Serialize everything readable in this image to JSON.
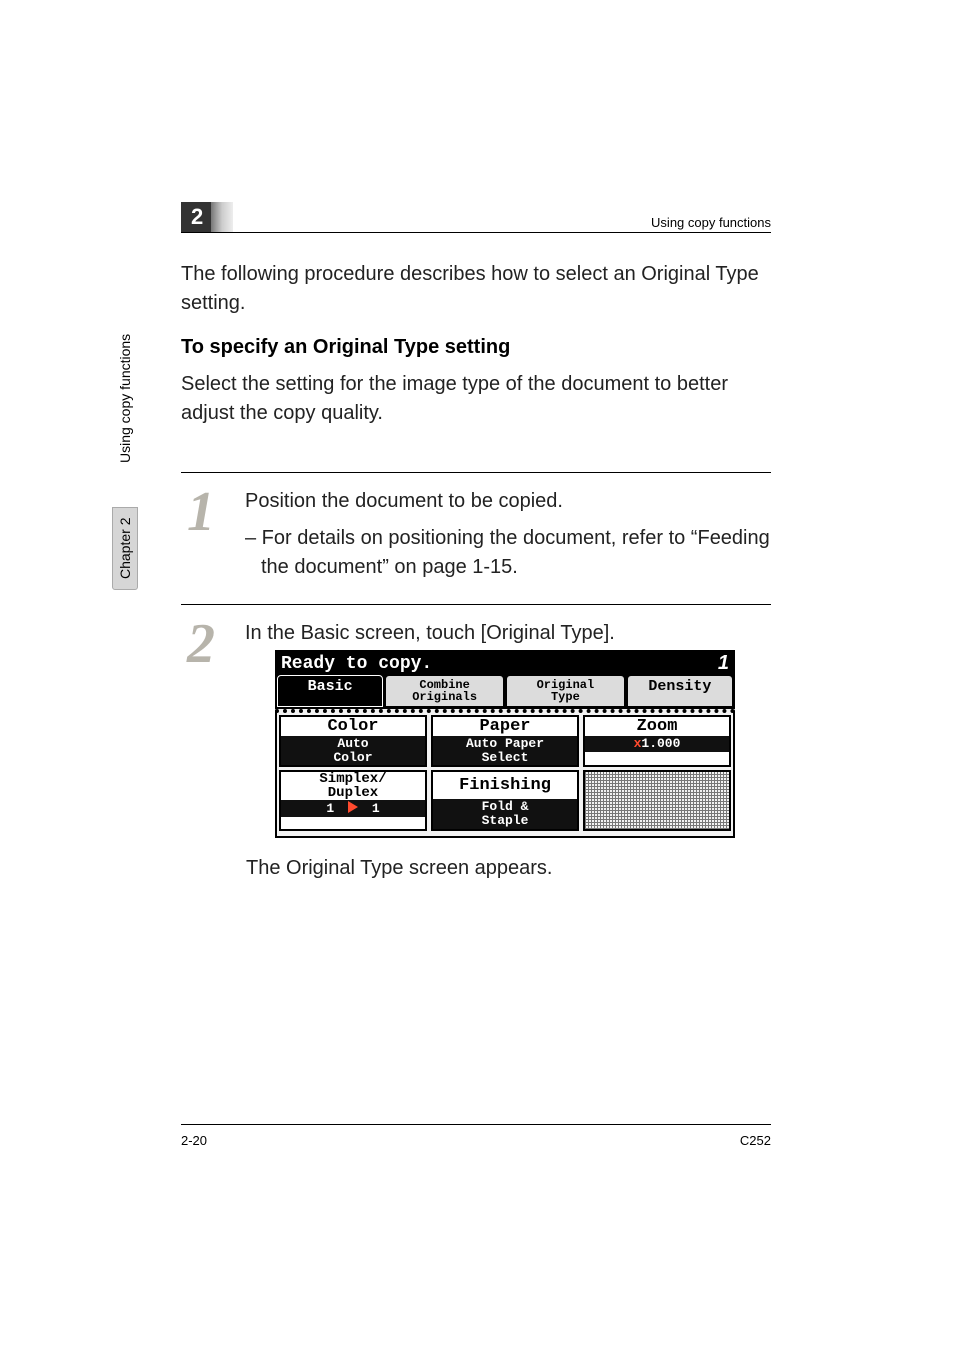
{
  "header": {
    "chapter_num": "2",
    "title_right": "Using copy functions"
  },
  "sidebar": {
    "chapter_label": "Chapter 2",
    "section_label": "Using copy functions"
  },
  "body": {
    "intro": "The following procedure describes how to select an Original Type setting.",
    "heading": "To specify an Original Type setting",
    "para2": "Select the setting for the image type of the document to better adjust the copy quality."
  },
  "steps": [
    {
      "num": "1",
      "text": "Position the document to be copied.",
      "sub": "– For details on positioning the document, refer to “Feeding the document” on page 1-15."
    },
    {
      "num": "2",
      "text": "In the Basic screen, touch [Original Type].",
      "after": "The Original Type screen appears."
    }
  ],
  "figure": {
    "status": "Ready to copy.",
    "count": "1",
    "tabs": {
      "basic": "Basic",
      "combine1": "Combine",
      "combine2": "Originals",
      "orig1": "Original",
      "orig2": "Type",
      "density": "Density"
    },
    "grid": {
      "color_hd": "Color",
      "color_val": "Auto\nColor",
      "paper_hd": "Paper",
      "paper_val": "Auto Paper\nSelect",
      "zoom_hd": "Zoom",
      "zoom_val_x": "x",
      "zoom_val_num": "1.000",
      "duplex_hd": "Simplex/\nDuplex",
      "duplex_a": "1",
      "duplex_b": "1",
      "finishing": "Finishing",
      "fold": "Fold &\nStaple"
    }
  },
  "footer": {
    "left": "2-20",
    "right": "C252"
  }
}
